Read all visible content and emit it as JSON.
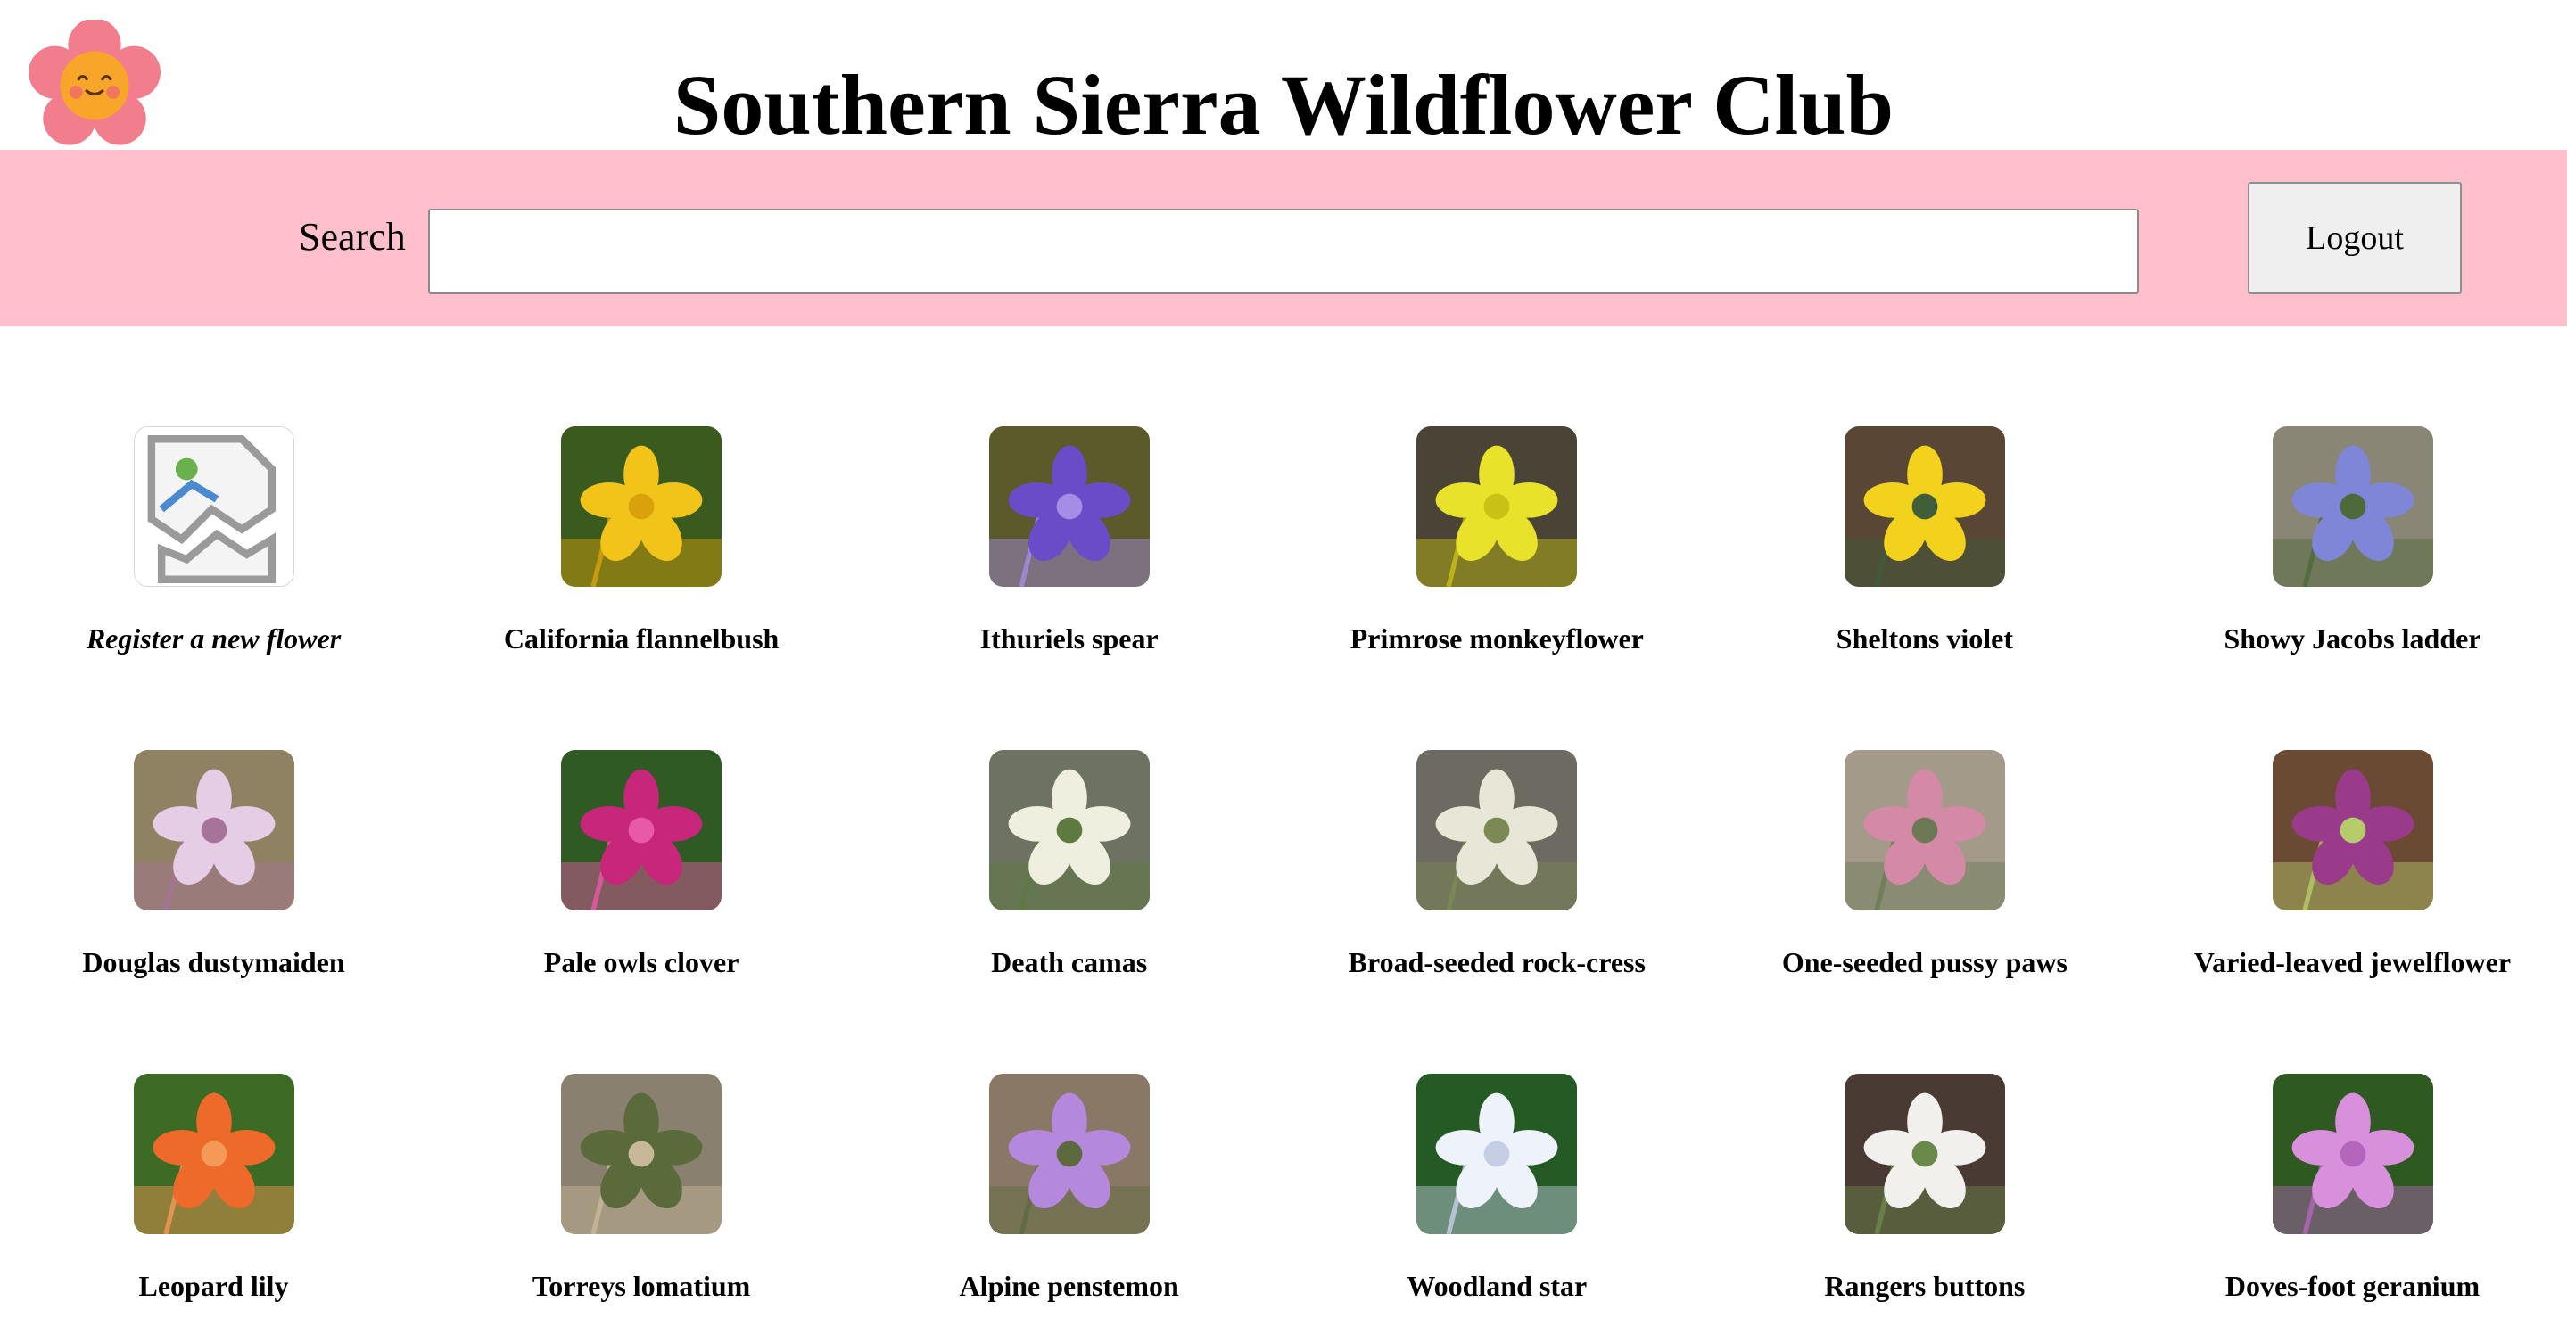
{
  "header": {
    "title": "Southern Sierra Wildflower Club",
    "logo_icon": "smiling-flower-icon"
  },
  "search": {
    "label": "Search",
    "value": "",
    "placeholder": ""
  },
  "logout": {
    "label": "Logout"
  },
  "register": {
    "label": "Register a new flower",
    "icon": "broken-image-icon"
  },
  "flowers": [
    {
      "name": "California flannelbush",
      "colors": [
        "#3a5a1e",
        "#f2c318",
        "#d9a20c"
      ]
    },
    {
      "name": "Ithuriels spear",
      "colors": [
        "#5b5a2a",
        "#6a4cc8",
        "#a58de6"
      ]
    },
    {
      "name": "Primrose monkeyflower",
      "colors": [
        "#4a4436",
        "#e8e22a",
        "#c9c116"
      ]
    },
    {
      "name": "Sheltons violet",
      "colors": [
        "#5a4634",
        "#f3d21e",
        "#3f5e3a"
      ]
    },
    {
      "name": "Showy Jacobs ladder",
      "colors": [
        "#8a8676",
        "#7f86d8",
        "#4d6a3a"
      ]
    },
    {
      "name": "Douglas dustymaiden",
      "colors": [
        "#8e8262",
        "#e6cde6",
        "#a6739a"
      ]
    },
    {
      "name": "Pale owls clover",
      "colors": [
        "#2f5a24",
        "#c8267a",
        "#e85aa8"
      ]
    },
    {
      "name": "Death camas",
      "colors": [
        "#6e7262",
        "#efefe0",
        "#5d7a40"
      ]
    },
    {
      "name": "Broad-seeded rock-cress",
      "colors": [
        "#6d6a62",
        "#e8e6d6",
        "#7b8a54"
      ]
    },
    {
      "name": "One-seeded pussy paws",
      "colors": [
        "#a39a8a",
        "#d48aa6",
        "#6b7a54"
      ]
    },
    {
      "name": "Varied-leaved jewelflower",
      "colors": [
        "#6b4a34",
        "#9a3a8a",
        "#b6cc6a"
      ]
    },
    {
      "name": "Leopard lily",
      "colors": [
        "#3d6a24",
        "#ee6a2a",
        "#f49a56"
      ]
    },
    {
      "name": "Torreys lomatium",
      "colors": [
        "#8a8070",
        "#5a6a3a",
        "#c8b89a"
      ]
    },
    {
      "name": "Alpine penstemon",
      "colors": [
        "#8a7866",
        "#b488dc",
        "#5d6a3e"
      ]
    },
    {
      "name": "Woodland star",
      "colors": [
        "#245a24",
        "#eef2fa",
        "#c6cee6"
      ]
    },
    {
      "name": "Rangers buttons",
      "colors": [
        "#4a3a34",
        "#f2f0ec",
        "#6a8a4a"
      ]
    },
    {
      "name": "Doves-foot geranium",
      "colors": [
        "#2e5a22",
        "#d890dc",
        "#b466bc"
      ]
    }
  ]
}
